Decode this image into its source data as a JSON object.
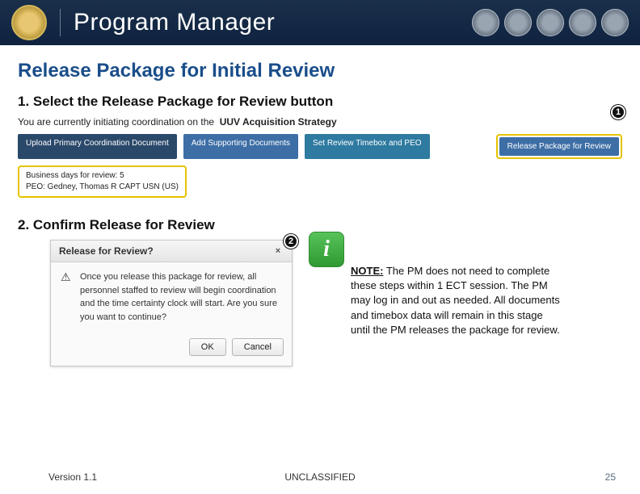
{
  "header": {
    "title_light": "Program",
    "title_bold": "Manager"
  },
  "page_title": "Release Package for Initial Review",
  "step1": {
    "heading": "1.  Select the Release Package for Review button",
    "coord_prefix": "You are currently initiating coordination on the",
    "doc_name": "UUV Acquisition Strategy",
    "buttons": {
      "upload": "Upload Primary Coordination Document",
      "support": "Add Supporting Documents",
      "timebox": "Set Review Timebox and PEO",
      "release": "Release Package for Review"
    },
    "info_line1": "Business days for review: 5",
    "info_line2": "PEO: Gedney, Thomas R CAPT USN (US)",
    "badge": "1"
  },
  "step2": {
    "heading": "2.  Confirm Release for Review",
    "dialog": {
      "title": "Release for Review?",
      "body": "Once you release this package for review, all personnel staffed to review will begin coordination and the time certainty clock will start. Are you sure you want to continue?",
      "ok": "OK",
      "cancel": "Cancel",
      "close": "×"
    },
    "badge": "2",
    "note_label": "NOTE:",
    "note_body": "The PM does not need to complete these steps within 1 ECT session.  The PM may log in and out as needed.  All documents and timebox data will remain in this stage until the PM releases the package for review.",
    "info_glyph": "i"
  },
  "footer": {
    "version": "Version 1.1",
    "classification": "UNCLASSIFIED",
    "page": "25"
  }
}
